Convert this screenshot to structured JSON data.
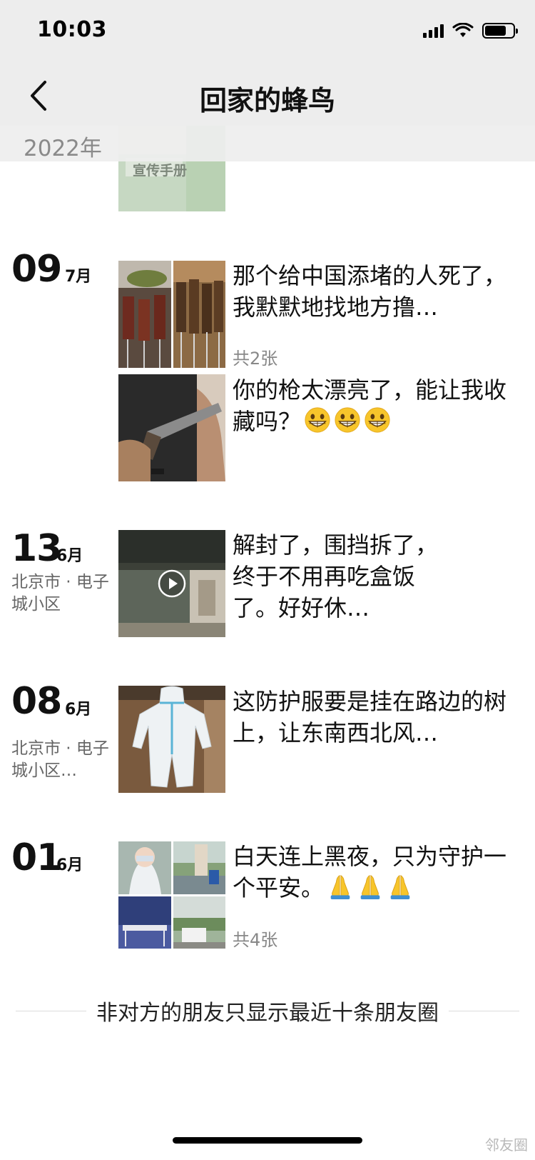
{
  "status_bar": {
    "time": "10:03"
  },
  "nav": {
    "title": "回家的蜂鸟"
  },
  "year": "2022年",
  "posts": [
    {
      "thumb_text": "宣传手册",
      "text": ""
    },
    {
      "day": "09",
      "month": "7月",
      "text": "那个给中国添堵的人死了，我默默地找地方撸…",
      "count": "共2张"
    },
    {
      "text": "你的枪太漂亮了，能让我收藏吗？",
      "emoji": "grinning-face-icon"
    },
    {
      "day": "13",
      "month": "6月",
      "location": "北京市 · 电子城小区",
      "text": "解封了，围挡拆了，终于不用再吃盒饭了。好好休…",
      "media": "video"
    },
    {
      "day": "08",
      "month": "6月",
      "location": "北京市 · 电子城小区…",
      "text": "这防护服要是挂在路边的树上，让东南西北风…"
    },
    {
      "day": "01",
      "month": "6月",
      "text": "白天连上黑夜，只为守护一个平安。",
      "emoji": "folded-hands-icon",
      "count": "共4张"
    }
  ],
  "footer": {
    "note": "非对方的朋友只显示最近十条朋友圈"
  },
  "watermark": "邻友圈",
  "colors": {
    "header_bg": "#ededed",
    "secondary_text": "#888888",
    "emoji_yellow": "#f7c52b"
  }
}
